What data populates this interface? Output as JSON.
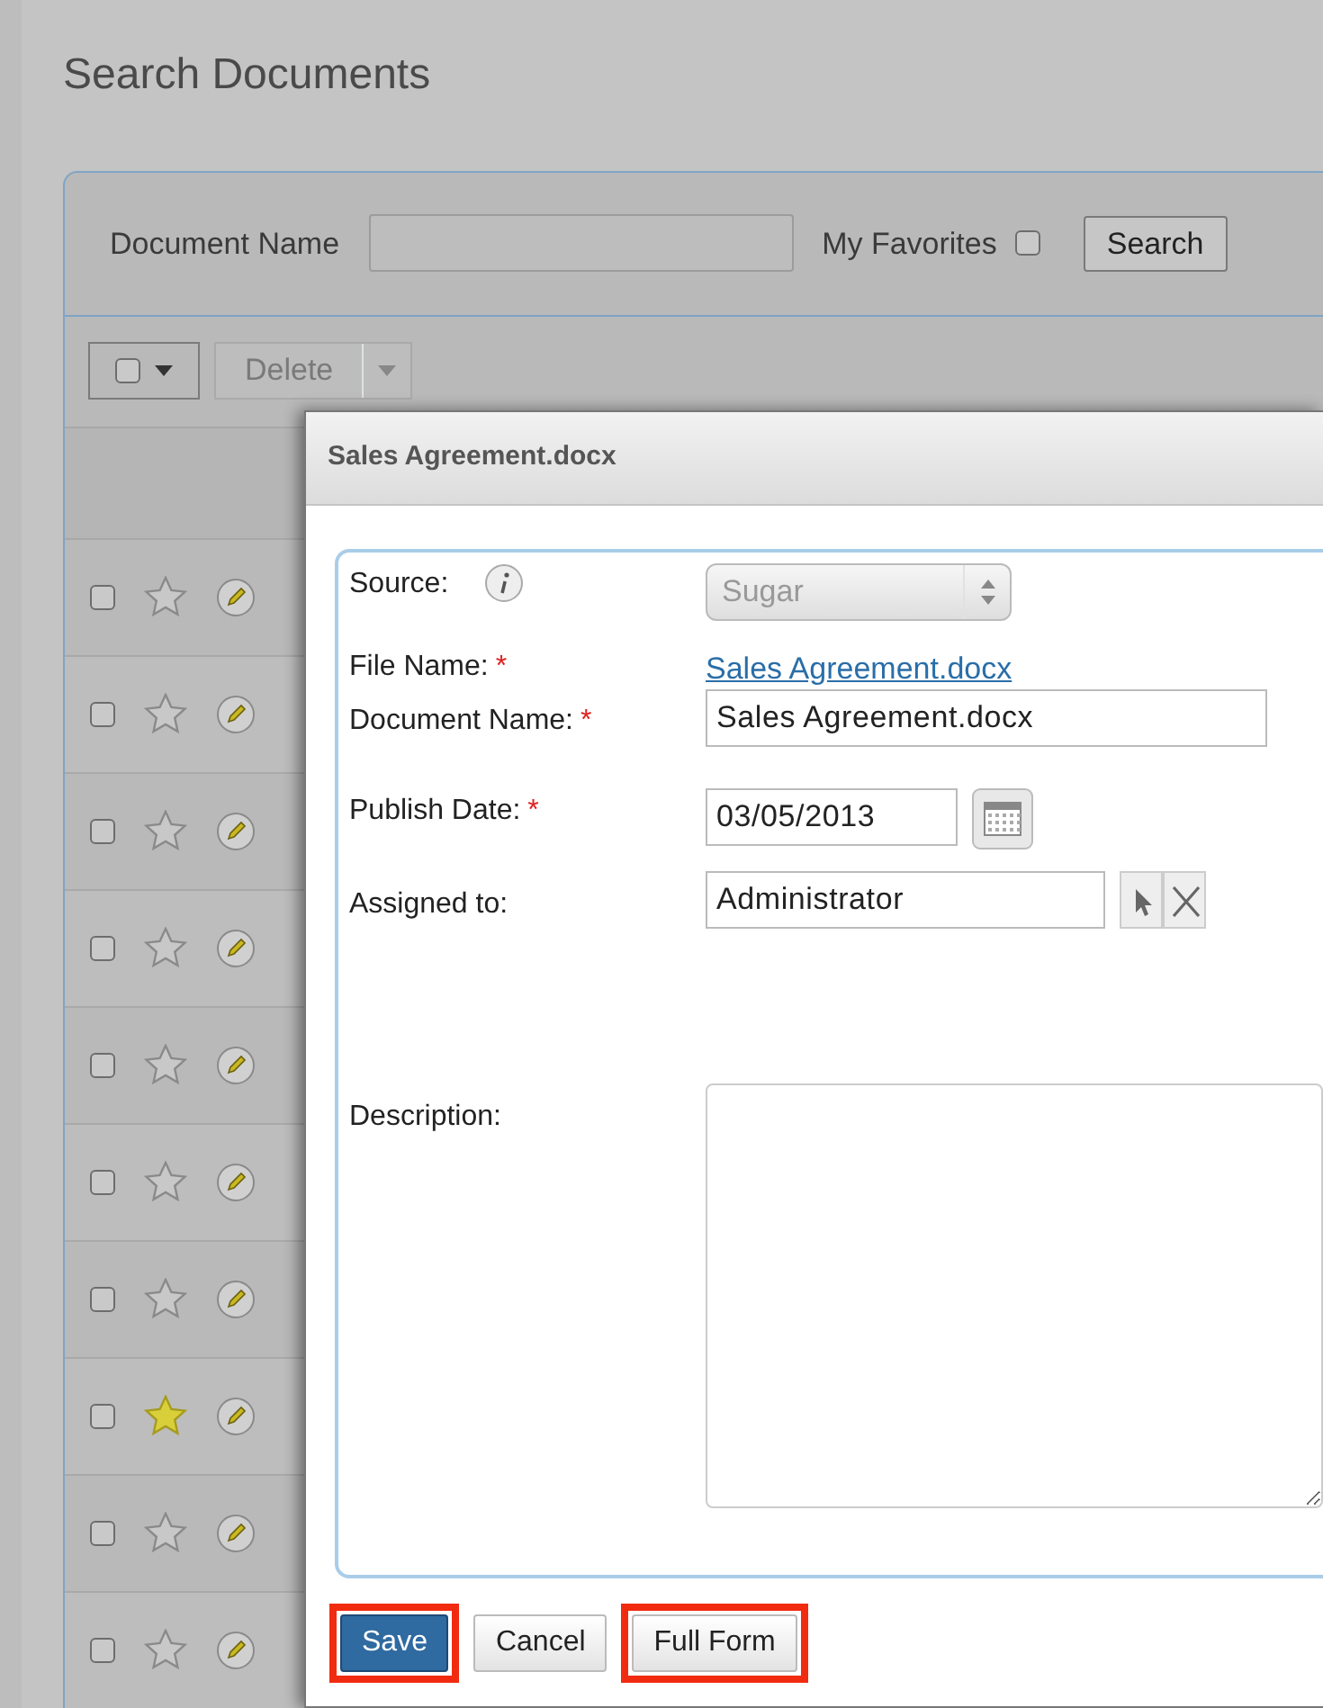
{
  "page": {
    "title": "Search Documents"
  },
  "search": {
    "document_name_label": "Document Name",
    "favorites_label": "My Favorites",
    "favorites_checked": false,
    "search_button": "Search"
  },
  "toolbar": {
    "select_all_checked": false,
    "delete_button": "Delete"
  },
  "rows": [
    {
      "checked": false,
      "favorite": false
    },
    {
      "checked": false,
      "favorite": false
    },
    {
      "checked": false,
      "favorite": false
    },
    {
      "checked": false,
      "favorite": false
    },
    {
      "checked": false,
      "favorite": false
    },
    {
      "checked": false,
      "favorite": false
    },
    {
      "checked": false,
      "favorite": false
    },
    {
      "checked": false,
      "favorite": true
    },
    {
      "checked": false,
      "favorite": false
    },
    {
      "checked": false,
      "favorite": false
    }
  ],
  "modal": {
    "title": "Sales Agreement.docx",
    "fields": [
      {
        "kind": "select",
        "label": "Source:",
        "info": true,
        "value": "Sugar",
        "disabled": true
      },
      {
        "kind": "link",
        "label": "File Name:",
        "required_mark": "*",
        "value": "Sales Agreement.docx"
      },
      {
        "kind": "text",
        "label": "Document Name:",
        "required_mark": "*",
        "value": "Sales Agreement.docx"
      },
      {
        "kind": "date",
        "label": "Publish Date:",
        "required_mark": "*",
        "value": "03/05/2013"
      },
      {
        "kind": "relate",
        "label": "Assigned to:",
        "value": "Administrator"
      },
      {
        "kind": "textarea",
        "label": "Description:"
      }
    ],
    "buttons": [
      {
        "label": "Save",
        "kind": "primary",
        "highlighted": true
      },
      {
        "label": "Cancel",
        "kind": "default",
        "highlighted": false
      },
      {
        "label": "Full Form",
        "kind": "default",
        "highlighted": true
      }
    ]
  }
}
